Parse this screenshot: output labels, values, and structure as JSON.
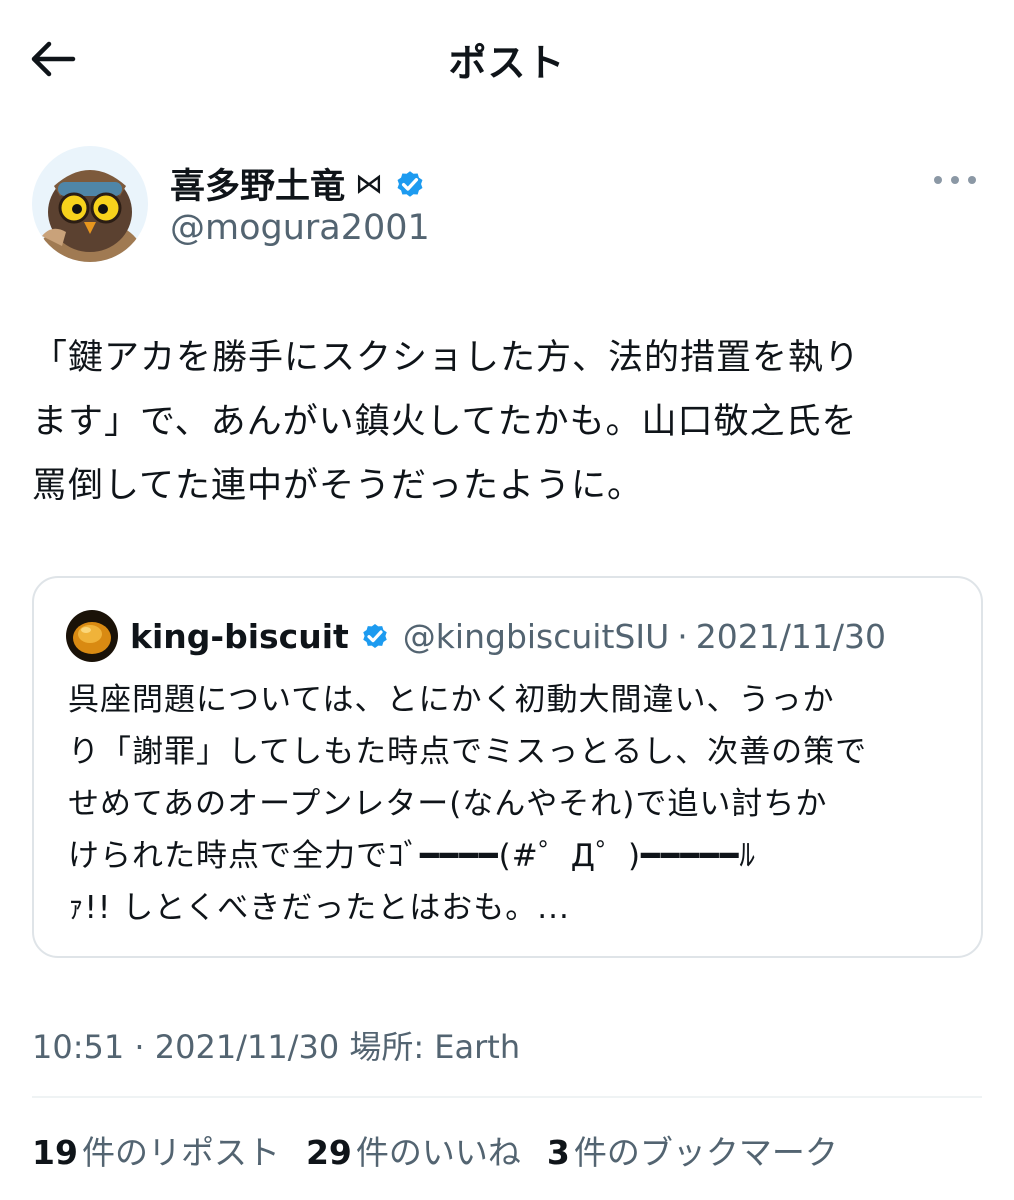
{
  "header": {
    "title": "ポスト",
    "back_icon": "arrow-left-icon"
  },
  "author": {
    "name": "喜多野土竜",
    "bowtie_glyph": "⋈",
    "handle": "@mogura2001",
    "verified": true,
    "avatar": "owl-aviator-avatar"
  },
  "post": {
    "lines": [
      "「鍵アカを勝手にスクショした方、法的措置を執り",
      "ます」で、あんがい鎮火してたかも。山口敬之氏を",
      "罵倒してた連中がそうだったように。"
    ]
  },
  "quote": {
    "name": "king-biscuit",
    "verified": true,
    "handle": "@kingbiscuitSIU",
    "dot": "·",
    "date": "2021/11/30",
    "lines": [
      "呉座問題については、とにかく初動大間違い、うっか",
      "り「謝罪」してしもた時点でミスっとるし、次善の策で",
      "せめてあのオープンレター(なんやそれ)で追い討ちか",
      "けられた時点で全力でｺﾞ━━━━(#゜Д゜)━━━━━ﾙ",
      "ｧ!! しとくべきだったとはおも。..."
    ]
  },
  "meta": {
    "text": "10:51 · 2021/11/30  場所: Earth"
  },
  "stats": {
    "reposts": {
      "num": "19",
      "label": "件のリポスト"
    },
    "likes": {
      "num": "29",
      "label": "件のいいね"
    },
    "bookmarks": {
      "num": "3",
      "label": "件のブックマーク"
    }
  },
  "colors": {
    "verified": "#1d9bf0",
    "secondary": "#536471",
    "text": "#0f1419",
    "border": "#dfe4e8"
  }
}
